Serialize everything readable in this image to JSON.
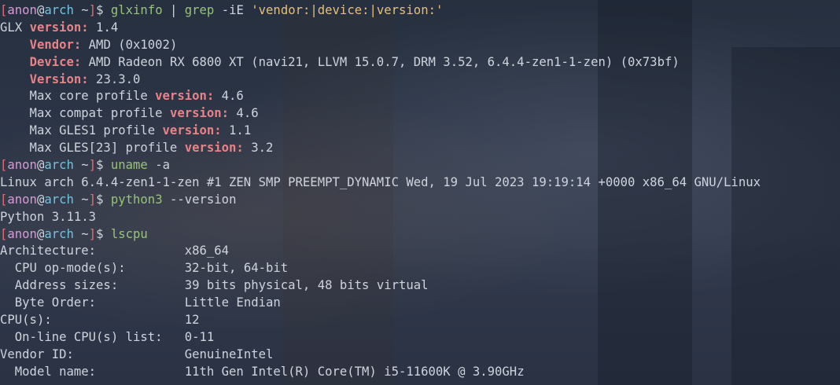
{
  "colors": {
    "prompt_bracket": "#e06c75",
    "prompt_user": "#d79bd6",
    "prompt_host": "#6ec4e0",
    "command": "#98c379",
    "string": "#e5c07b",
    "match": "#e88388",
    "text": "#cfd3dc"
  },
  "prompt": {
    "open": "[",
    "user": "anon",
    "at": "@",
    "host": "arch",
    "dir": " ~",
    "close": "]",
    "dollar": "$ "
  },
  "cmd1": {
    "name": "glxinfo",
    "pipe": " | ",
    "grep": "grep",
    "flags": " -iE ",
    "pattern": "'vendor:|device:|version:'"
  },
  "glx": {
    "l1_pre": "GLX ",
    "l1_key": "version:",
    "l1_val": " 1.4",
    "l2_pre": "    ",
    "l2_key": "Vendor:",
    "l2_val": " AMD (0x1002)",
    "l3_pre": "    ",
    "l3_key": "Device:",
    "l3_val": " AMD Radeon RX 6800 XT (navi21, LLVM 15.0.7, DRM 3.52, 6.4.4-zen1-1-zen) (0x73bf)",
    "l4_pre": "    ",
    "l4_key": "Version:",
    "l4_val": " 23.3.0",
    "l5_pre": "    Max core profile ",
    "l5_key": "version:",
    "l5_val": " 4.6",
    "l6_pre": "    Max compat profile ",
    "l6_key": "version:",
    "l6_val": " 4.6",
    "l7_pre": "    Max GLES1 profile ",
    "l7_key": "version:",
    "l7_val": " 1.1",
    "l8_pre": "    Max GLES[23] profile ",
    "l8_key": "version:",
    "l8_val": " 3.2"
  },
  "cmd2": {
    "name": "uname",
    "args": " -a"
  },
  "uname_out": "Linux arch 6.4.4-zen1-1-zen #1 ZEN SMP PREEMPT_DYNAMIC Wed, 19 Jul 2023 19:19:14 +0000 x86_64 GNU/Linux",
  "cmd3": {
    "name": "python3",
    "args": " --version"
  },
  "python_out": "Python 3.11.3",
  "cmd4": {
    "name": "lscpu",
    "args": ""
  },
  "lscpu": [
    {
      "label": "Architecture:",
      "value": "x86_64"
    },
    {
      "label": "  CPU op-mode(s):",
      "value": "32-bit, 64-bit"
    },
    {
      "label": "  Address sizes:",
      "value": "39 bits physical, 48 bits virtual"
    },
    {
      "label": "  Byte Order:",
      "value": "Little Endian"
    },
    {
      "label": "CPU(s):",
      "value": "12"
    },
    {
      "label": "  On-line CPU(s) list:",
      "value": "0-11"
    },
    {
      "label": "Vendor ID:",
      "value": "GenuineIntel"
    },
    {
      "label": "  Model name:",
      "value": "11th Gen Intel(R) Core(TM) i5-11600K @ 3.90GHz"
    }
  ]
}
